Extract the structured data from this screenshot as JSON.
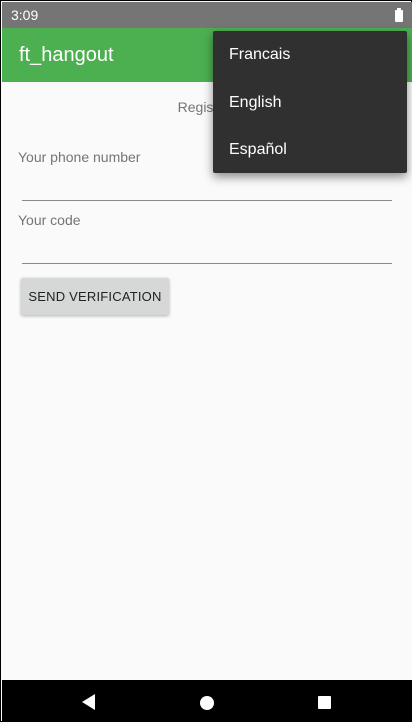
{
  "status_bar": {
    "time": "3:09"
  },
  "app_bar": {
    "title": "ft_hangout"
  },
  "registration": {
    "title": "Registration",
    "phone_label": "Your phone number",
    "phone_value": "",
    "code_label": "Your code",
    "code_value": "",
    "send_button": "SEND VERIFICATION"
  },
  "language_menu": {
    "items": [
      "Francais",
      "English",
      "Español"
    ]
  },
  "colors": {
    "app_bar": "#4caf50",
    "status_bar": "#757575",
    "menu_background": "#303030",
    "button_background": "#d6d7d7"
  },
  "nav_bar": {
    "icons": [
      "back-icon",
      "home-icon",
      "recents-icon"
    ]
  }
}
